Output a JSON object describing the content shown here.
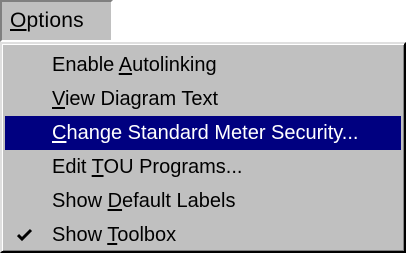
{
  "menu": {
    "title_mnemonic": "O",
    "title_rest": "ptions",
    "items": [
      {
        "pre": "Enable ",
        "mnemonic": "A",
        "post": "utolinking",
        "checked": false,
        "selected": false
      },
      {
        "pre": "",
        "mnemonic": "V",
        "post": "iew Diagram Text",
        "checked": false,
        "selected": false
      },
      {
        "pre": "",
        "mnemonic": "C",
        "post": "hange Standard Meter Security...",
        "checked": false,
        "selected": true
      },
      {
        "pre": "Edit ",
        "mnemonic": "T",
        "post": "OU Programs...",
        "checked": false,
        "selected": false
      },
      {
        "pre": "Show ",
        "mnemonic": "D",
        "post": "efault Labels",
        "checked": false,
        "selected": false
      },
      {
        "pre": "Show ",
        "mnemonic": "T",
        "post": "oolbox",
        "checked": true,
        "selected": false
      }
    ]
  },
  "icons": {
    "checkmark": "checkmark-icon"
  },
  "colors": {
    "menu_bg": "#c0c0c0",
    "highlight_bg": "#000080",
    "highlight_text": "#ffffff",
    "text": "#000000"
  }
}
